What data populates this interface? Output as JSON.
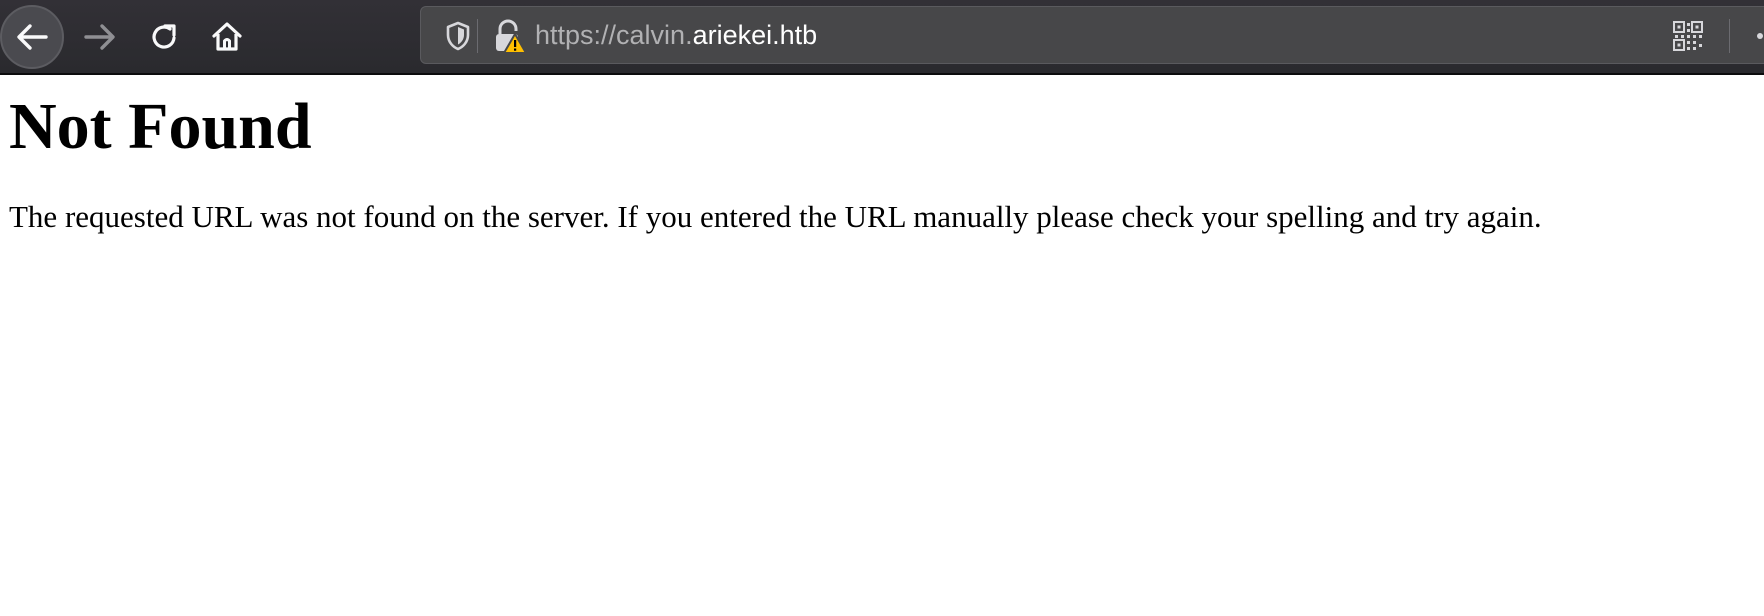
{
  "browser": {
    "toolbar": {
      "back_icon": "arrow-left-icon",
      "forward_icon": "arrow-right-icon",
      "reload_icon": "reload-icon",
      "home_icon": "home-icon"
    },
    "urlbar": {
      "scheme_part": "https://calvin.",
      "domain_part": "ariekei.htb",
      "tracking_icon": "shield-icon",
      "security_icon": "lock-warning-icon",
      "qr_icon": "qr-code-icon"
    }
  },
  "page": {
    "heading": "Not Found",
    "message": "The requested URL was not found on the server. If you entered the URL manually please check your spelling and try again."
  },
  "colors": {
    "toolbar_bg": "#2a2a2e",
    "urlbar_bg": "#474749",
    "warning": "#ffbf00"
  }
}
